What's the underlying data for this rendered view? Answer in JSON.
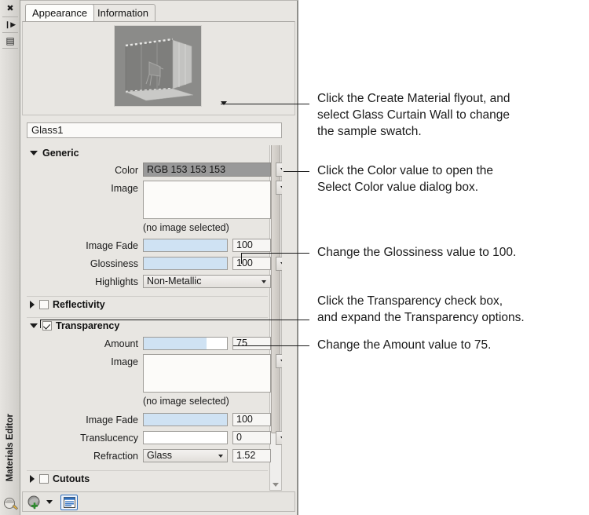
{
  "palette": {
    "title": "Materials Editor",
    "vbar_buttons": [
      {
        "name": "close-icon",
        "glyph": "✖"
      },
      {
        "name": "auto-hide-icon",
        "glyph": "❙▶"
      },
      {
        "name": "panel-properties-icon",
        "glyph": "▤"
      }
    ],
    "tabs": [
      {
        "label": "Appearance",
        "active": true
      },
      {
        "label": "Information",
        "active": false
      }
    ],
    "name_field": {
      "value": "Glass1",
      "placeholder": "Material name"
    },
    "sections": {
      "generic": {
        "label": "Generic",
        "expanded": true,
        "rows": {
          "color": {
            "label": "Color",
            "value": "RGB 153 153 153",
            "swatch_hex": "#999999"
          },
          "image": {
            "label": "Image",
            "value": "",
            "status": "(no image selected)"
          },
          "image_fade": {
            "label": "Image Fade",
            "value": "100",
            "percent": 100
          },
          "glossiness": {
            "label": "Glossiness",
            "value": "100",
            "percent": 100
          },
          "highlights": {
            "label": "Highlights",
            "value": "Non-Metallic"
          }
        }
      },
      "reflectivity": {
        "label": "Reflectivity",
        "expanded": false,
        "checked": false
      },
      "transparency": {
        "label": "Transparency",
        "expanded": true,
        "checked": true,
        "rows": {
          "amount": {
            "label": "Amount",
            "value": "75",
            "percent": 75
          },
          "image": {
            "label": "Image",
            "value": "",
            "status": "(no image selected)"
          },
          "image_fade": {
            "label": "Image Fade",
            "value": "100",
            "percent": 100
          },
          "translucency": {
            "label": "Translucency",
            "value": "0",
            "percent": 0
          },
          "refraction": {
            "label": "Refraction",
            "preset": "Glass",
            "value": "1.52"
          }
        }
      },
      "cutouts": {
        "label": "Cutouts",
        "expanded": false,
        "checked": false
      }
    },
    "bottom_toolbar": [
      {
        "name": "create-material-button",
        "label": ""
      },
      {
        "name": "toggle-document-materials-button",
        "label": ""
      }
    ],
    "accent_hex": "#cfe2f3"
  },
  "annotations": [
    {
      "name": "annotation-create-material-flyout",
      "text": "Click the Create Material flyout, and\nselect Glass Curtain Wall to change\nthe sample swatch."
    },
    {
      "name": "annotation-color-value",
      "text": "Click the Color value to open the\nSelect Color value dialog box."
    },
    {
      "name": "annotation-glossiness",
      "text": "Change the Glossiness value to 100."
    },
    {
      "name": "annotation-transparency-checkbox",
      "text": "Click the Transparency check box,\nand expand the Transparency options."
    },
    {
      "name": "annotation-amount",
      "text": "Change the Amount value to 75."
    }
  ]
}
